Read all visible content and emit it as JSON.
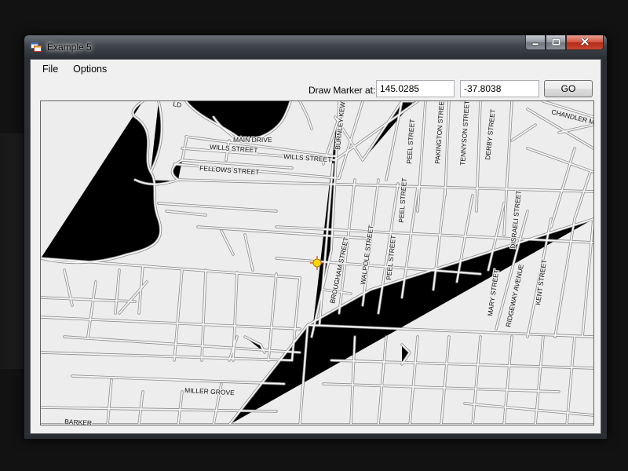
{
  "window": {
    "title": "Example 5",
    "icon": "app-window-icon",
    "caption_buttons": [
      "minimize-icon",
      "maximize-icon",
      "close-icon"
    ]
  },
  "menu": {
    "items": [
      "File",
      "Options"
    ]
  },
  "toolbar": {
    "label": "Draw Marker at:",
    "longitude_value": "145.0285",
    "latitude_value": "-37.8038",
    "go_label": "GO"
  },
  "map": {
    "streets": {
      "main_drive": "MAIN DRIVE",
      "wills_street_1": "WILLS STREET",
      "wills_street_2": "WILLS STREET",
      "fellows_street": "FELLOWS STREET",
      "burnley_kew": "BURNLEY-KEW",
      "peel_street_1": "PEEL STREET",
      "peel_street_2": "PEEL STREET",
      "peel_street_3": "PEEL STREET",
      "pakington_street": "PAKINGTON STREET",
      "tennyson_street": "TENNYSON STREET",
      "derby_street": "DERBY STREET",
      "chandler": "CHANDLER M",
      "disraeli_street": "DISRAELI STREET",
      "brougham_street": "BROUGHAM STREET",
      "walpole_street": "WALPOLE STREET",
      "mary_street": "MARY STREET",
      "ridgeway_avenue": "RIDGEWAY AVENUE",
      "kent_street": "KENT STREET",
      "miller_grove": "MILLER GROVE",
      "barker": "BARKER",
      "partial_top": "LD"
    },
    "marker_color": "#ffd800",
    "marker_cross_color": "#e33b1a"
  }
}
